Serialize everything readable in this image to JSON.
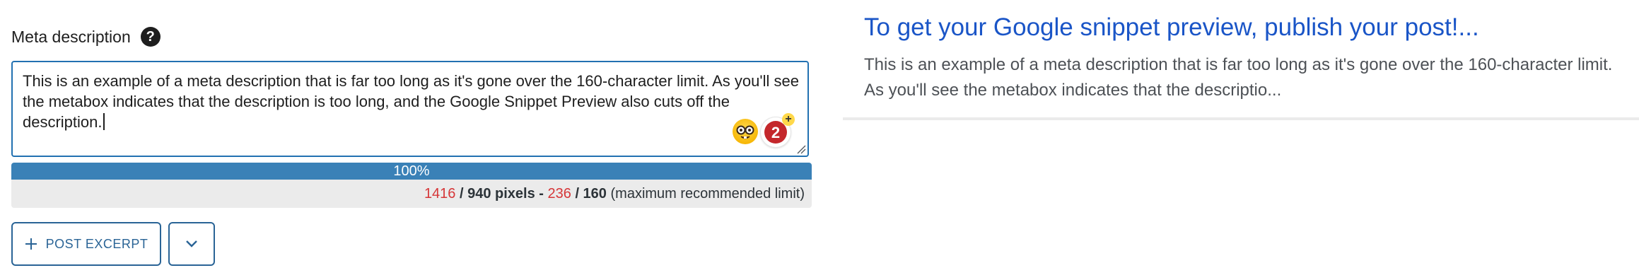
{
  "meta": {
    "label": "Meta description",
    "help_icon": "question-mark-icon",
    "text": "This is an example of a meta description that is far too long as it's gone over the 160-character limit. As you'll see the metabox indicates that the description is too long, and the Google Snippet Preview also cuts off the description."
  },
  "grammar": {
    "emoji_icon": "nerd-face-emoji-icon",
    "badge_count": "2",
    "badge_plus": "+"
  },
  "progress": {
    "value_percent": 100,
    "label": "100%",
    "bar_color": "#3a81b7"
  },
  "counter": {
    "pixels_used": "1416",
    "pixels_sep": " / 940 pixels - ",
    "chars_used": "236",
    "chars_sep": " / 160",
    "note": " (maximum recommended limit)",
    "over_color": "#d63638"
  },
  "buttons": {
    "post_excerpt_label": "POST EXCERPT",
    "plus_icon": "plus-icon",
    "toggle_icon": "chevron-down-icon"
  },
  "snippet": {
    "title": "To get your Google snippet preview, publish your post!...",
    "description": "This is an example of a meta description that is far too long as it's gone over the 160-character limit. As you'll see the metabox indicates that the descriptio...",
    "title_color": "#1a55c7"
  }
}
